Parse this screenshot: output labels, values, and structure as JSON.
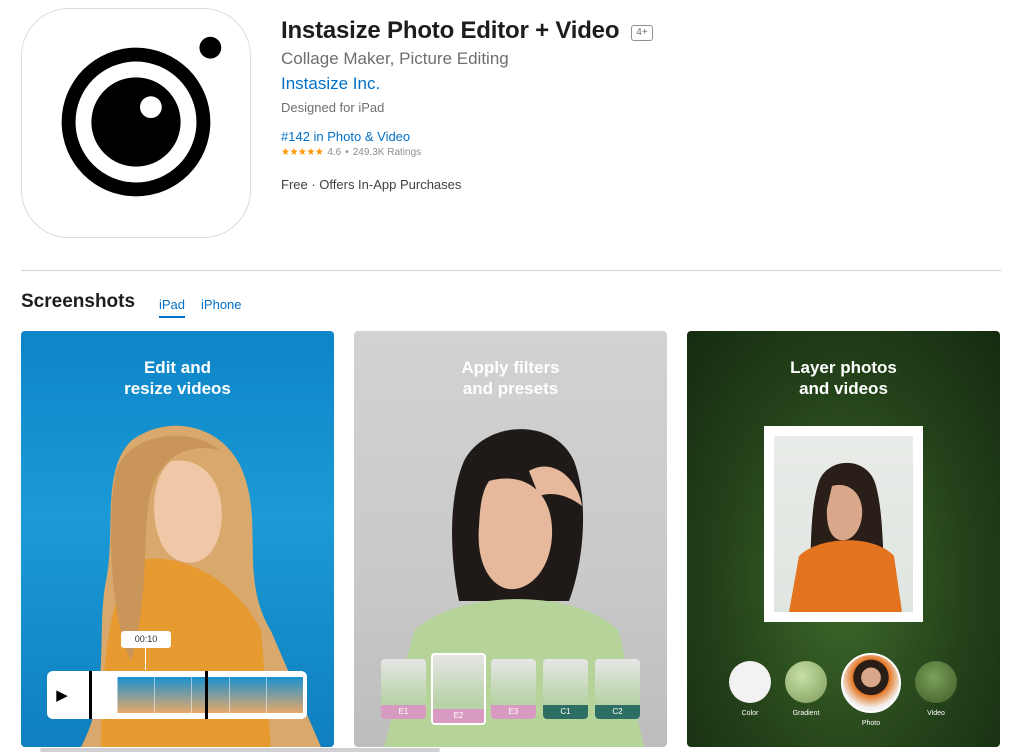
{
  "app": {
    "title": "Instasize Photo Editor + Video",
    "age_rating": "4+",
    "subtitle": "Collage Maker, Picture Editing",
    "developer": "Instasize Inc.",
    "designed_for": "Designed for iPad",
    "rank": "#142 in Photo & Video",
    "stars": "★★★★★",
    "rating": "4.6",
    "rating_sep": "•",
    "ratings_count": "249.3K Ratings",
    "price_line": "Free · Offers In-App Purchases"
  },
  "screenshots": {
    "section_title": "Screenshots",
    "tabs": [
      {
        "label": "iPad",
        "active": true
      },
      {
        "label": "iPhone",
        "active": false
      }
    ],
    "items": [
      {
        "caption": "Edit and\nresize videos",
        "time_tag": "00:10",
        "play_icon": "▶"
      },
      {
        "caption": "Apply filters\nand presets",
        "filters": [
          "E1",
          "E2",
          "E3",
          "C1",
          "C2"
        ],
        "selected_filter": "E2"
      },
      {
        "caption": "Layer photos\nand videos",
        "bg_options": [
          "Color",
          "Gradient",
          "Photo",
          "Video"
        ],
        "selected_option": "Photo"
      }
    ]
  },
  "colors": {
    "link": "#0070c9",
    "star": "#ff9500",
    "filter_pink": "#d79ac0",
    "filter_teal": "#2f6e62"
  }
}
